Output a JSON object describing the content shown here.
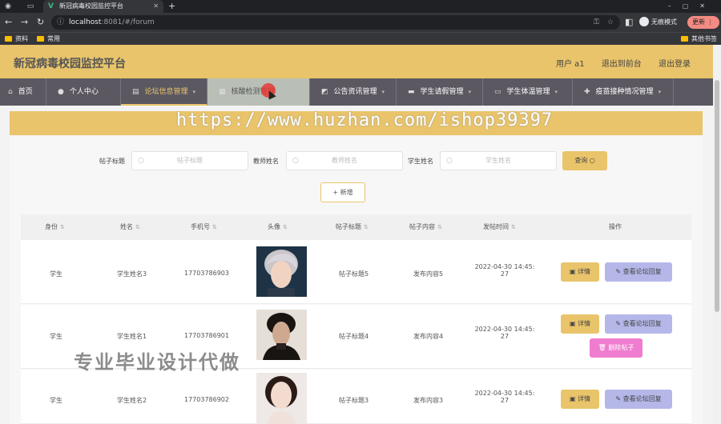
{
  "browser": {
    "tab_title": "新冠病毒校园监控平台",
    "url_host": "localhost",
    "url_path": ":8081/#/forum",
    "incognito_label": "无痕模式",
    "update_label": "更新",
    "bookmarks": [
      "资料",
      "常用",
      "其他书签"
    ]
  },
  "app": {
    "title": "新冠病毒校园监控平台",
    "user_label": "用户 a1",
    "front_label": "退出到前台",
    "logout_label": "退出登录"
  },
  "menu": {
    "items": [
      {
        "label": "首页",
        "icon": "home-icon"
      },
      {
        "label": "个人中心",
        "icon": "user-icon"
      },
      {
        "label": "论坛信息管理",
        "icon": "forum-icon"
      },
      {
        "label": "核酸检测管理",
        "icon": "test-icon"
      },
      {
        "label": "公告资讯管理",
        "icon": "notice-icon"
      },
      {
        "label": "学生请假管理",
        "icon": "leave-icon"
      },
      {
        "label": "学生体温管理",
        "icon": "temperature-icon"
      },
      {
        "label": "疫苗接种情况管理",
        "icon": "vaccine-icon"
      }
    ]
  },
  "watermark": "https://www.huzhan.com/ishop39397",
  "overlay_text": "专业毕业设计代做",
  "search": {
    "title_label": "帖子标题",
    "title_placeholder": "帖子标题",
    "teacher_label": "教师姓名",
    "teacher_placeholder": "教师姓名",
    "student_label": "学生姓名",
    "student_placeholder": "学生姓名",
    "query_label": "查询",
    "add_label": "新增"
  },
  "table": {
    "headers": [
      "身份",
      "姓名",
      "手机号",
      "头像",
      "帖子标题",
      "帖子内容",
      "发帖时间",
      "操作"
    ],
    "rows": [
      {
        "role": "学生",
        "name": "学生姓名3",
        "phone": "17703786903",
        "title": "帖子标题5",
        "content": "发布内容5",
        "time1": "2022-04-30 14:45:",
        "time2": "27"
      },
      {
        "role": "学生",
        "name": "学生姓名1",
        "phone": "17703786901",
        "title": "帖子标题4",
        "content": "发布内容4",
        "time1": "2022-04-30 14:45:",
        "time2": "27"
      },
      {
        "role": "学生",
        "name": "学生姓名2",
        "phone": "17703786902",
        "title": "帖子标题3",
        "content": "发布内容3",
        "time1": "2022-04-30 14:45:",
        "time2": "27"
      }
    ],
    "detail_label": "详情",
    "reply_label": "查看论坛回复",
    "delete_label": "删除帖子"
  }
}
